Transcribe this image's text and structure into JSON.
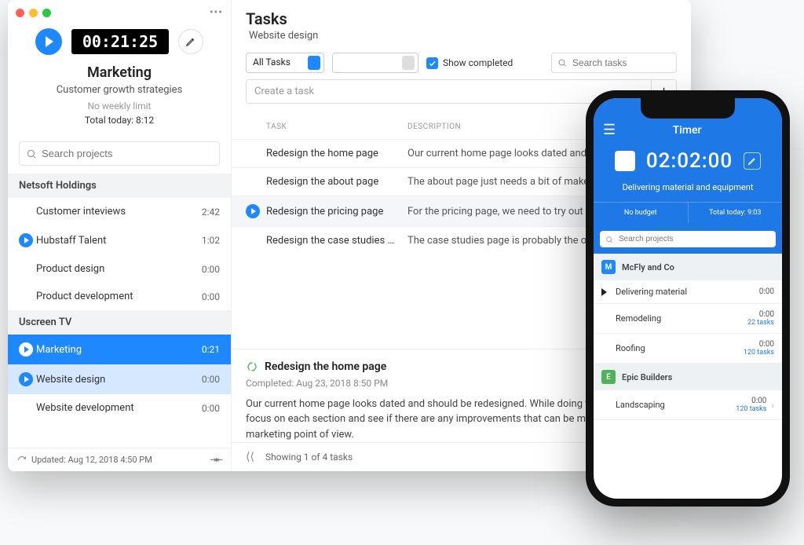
{
  "sidebar": {
    "timer_value": "00:21:25",
    "project_title": "Marketing",
    "project_subtitle": "Customer growth strategies",
    "weekly_limit": "No weekly limit",
    "total_today": "Total today: 8:12",
    "search_placeholder": "Search projects",
    "footer_updated": "Updated: Aug 12, 2018 4:50 PM",
    "orgs": [
      {
        "name": "Netsoft Holdings",
        "projects": [
          {
            "name": "Customer inteviews",
            "time": "2:42",
            "play": false
          },
          {
            "name": "Hubstaff Talent",
            "time": "1:02",
            "play": true
          },
          {
            "name": "Product design",
            "time": "0:00",
            "play": false
          },
          {
            "name": "Product development",
            "time": "0:00",
            "play": false
          }
        ]
      },
      {
        "name": "Uscreen TV",
        "projects": [
          {
            "name": "Marketing",
            "time": "0:21",
            "play": true,
            "selected": true
          },
          {
            "name": "Website design",
            "time": "0:00",
            "play": true,
            "active_light": true
          },
          {
            "name": "Website development",
            "time": "0:00",
            "play": false
          }
        ]
      }
    ]
  },
  "main": {
    "title": "Tasks",
    "subtitle": "Website design",
    "filter_all": "All Tasks",
    "show_completed_label": "Show completed",
    "search_placeholder": "Search tasks",
    "create_placeholder": "Create a task",
    "col_task": "TASK",
    "col_desc": "DESCRIPTION",
    "rows": [
      {
        "task": "Redesign the home page",
        "desc": "Our current home page looks dated and should..."
      },
      {
        "task": "Redesign the about page",
        "desc": "The about page just needs a bit of makeup, bec..."
      },
      {
        "task": "Redesign the pricing page",
        "desc": "For the pricing page, we need to try out a differe...",
        "selected": true,
        "play": true
      },
      {
        "task": "Redesign the case studies pa...",
        "desc": "The case studies page is probably the one that ..."
      }
    ],
    "detail": {
      "title": "Redesign the home page",
      "completed": "Completed: Aug 23, 2018 8:50 PM",
      "body": "Our current home page looks dated and should be redesigned. While doing this we can also focus on each section and see if there are any improvements that can be made from a marketing point of view."
    },
    "showing": "Showing 1 of 4 tasks"
  },
  "phone": {
    "title": "Timer",
    "timer": "02:02:00",
    "subtitle": "Delivering material and equipment",
    "budget": "No budget",
    "total": "Total today: 9:03",
    "search_placeholder": "Search projects",
    "orgs": [
      {
        "letter": "M",
        "name": "McFly and Co",
        "cls": "m",
        "items": [
          {
            "name": "Delivering material",
            "time": "0:00",
            "sub": "",
            "play": true
          },
          {
            "name": "Remodeling",
            "time": "0:00",
            "sub": "22 tasks"
          },
          {
            "name": "Roofing",
            "time": "0:00",
            "sub": "120 tasks"
          }
        ]
      },
      {
        "letter": "E",
        "name": "Epic Builders",
        "cls": "e",
        "items": [
          {
            "name": "Landscaping",
            "time": "0:00",
            "sub": "120 tasks",
            "chevron": true
          }
        ]
      }
    ]
  }
}
